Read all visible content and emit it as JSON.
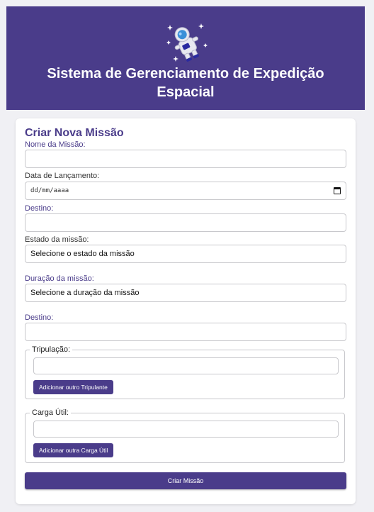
{
  "header": {
    "title": "Sistema de Gerenciamento de Expedição Espacial",
    "logo_icon": "astronaut-icon"
  },
  "form": {
    "title": "Criar Nova Missão",
    "mission_name": {
      "label": "Nome da Missão:",
      "value": ""
    },
    "launch_date": {
      "label": "Data de Lançamento:",
      "placeholder": "dd/mm/aaaa"
    },
    "destination": {
      "label": "Destino:",
      "value": ""
    },
    "mission_status": {
      "label": "Estado da missão:",
      "value": "Selecione o estado da missão"
    },
    "mission_duration": {
      "label": "Duração da missão:",
      "value": "Selecione a duração da missão"
    },
    "destination2": {
      "label": "Destino:",
      "value": ""
    },
    "crew": {
      "legend": "Tripulação:",
      "value": "",
      "add_label": "Adicionar outro Tripulante"
    },
    "payload": {
      "legend": "Carga Útil:",
      "value": "",
      "add_label": "Adicionar outra Carga Útil"
    },
    "submit_label": "Criar Missão"
  },
  "colors": {
    "accent": "#4a3c8a",
    "background": "#f0f0f4"
  }
}
